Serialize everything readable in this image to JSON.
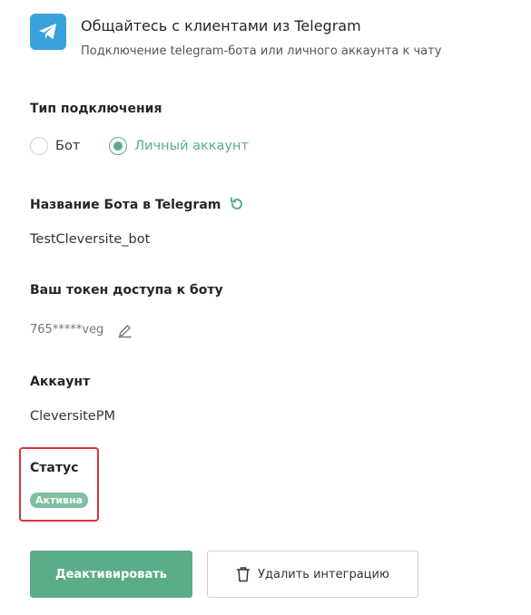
{
  "header": {
    "title": "Общайтесь с клиентами из Telegram",
    "subtitle": "Подключение telegram-бота или личного аккаунта к чату",
    "icon": "telegram-icon"
  },
  "connection_type": {
    "label": "Тип подключения",
    "options": [
      {
        "label": "Бот",
        "selected": false
      },
      {
        "label": "Личный аккаунт",
        "selected": true
      }
    ]
  },
  "bot_name": {
    "label": "Название Бота в Telegram",
    "value": "TestCleversite_bot"
  },
  "token": {
    "label": "Ваш токен доступа к боту",
    "value": "765*****veg"
  },
  "account": {
    "label": "Аккаунт",
    "value": "CleversitePM"
  },
  "status": {
    "label": "Статус",
    "badge": "Активна"
  },
  "actions": {
    "deactivate": "Деактивировать",
    "delete": "Удалить интеграцию"
  },
  "colors": {
    "accent": "#5aad88",
    "telegram": "#3aa2dc",
    "highlight": "#d9363e"
  }
}
